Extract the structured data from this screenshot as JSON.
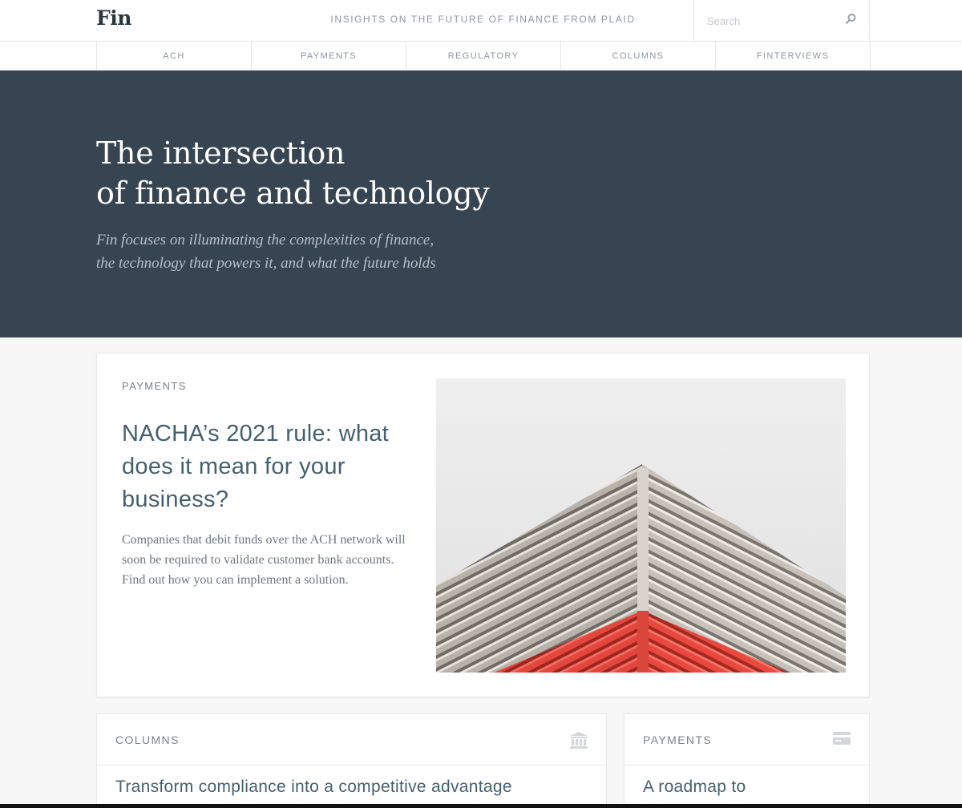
{
  "header": {
    "logo": "Fin",
    "tagline": "INSIGHTS ON THE FUTURE OF FINANCE FROM PLAID",
    "search_placeholder": "Search"
  },
  "nav": {
    "items": [
      {
        "label": "ACH"
      },
      {
        "label": "PAYMENTS"
      },
      {
        "label": "REGULATORY"
      },
      {
        "label": "COLUMNS"
      },
      {
        "label": "FINTERVIEWS"
      }
    ]
  },
  "hero": {
    "title_line1": "The intersection",
    "title_line2": "of finance and technology",
    "subtitle_line1": "Fin focuses on illuminating the complexities of finance,",
    "subtitle_line2": "the technology that powers it, and what the future holds"
  },
  "featured": {
    "category": "PAYMENTS",
    "title": "NACHA’s 2021 rule: what does it mean for your business?",
    "description": "Companies that debit funds over the ACH network will soon be required to validate customer bank accounts. Find out how you can implement a solution."
  },
  "cards": [
    {
      "category": "COLUMNS",
      "icon": "bank-icon",
      "title": "Transform compliance into a competitive advantage"
    },
    {
      "category": "PAYMENTS",
      "icon": "credit-card-icon",
      "title": "A roadmap to"
    }
  ],
  "colors": {
    "hero_bg": "#374451",
    "title_accent": "#44606f",
    "building_red": "#e8463a"
  }
}
